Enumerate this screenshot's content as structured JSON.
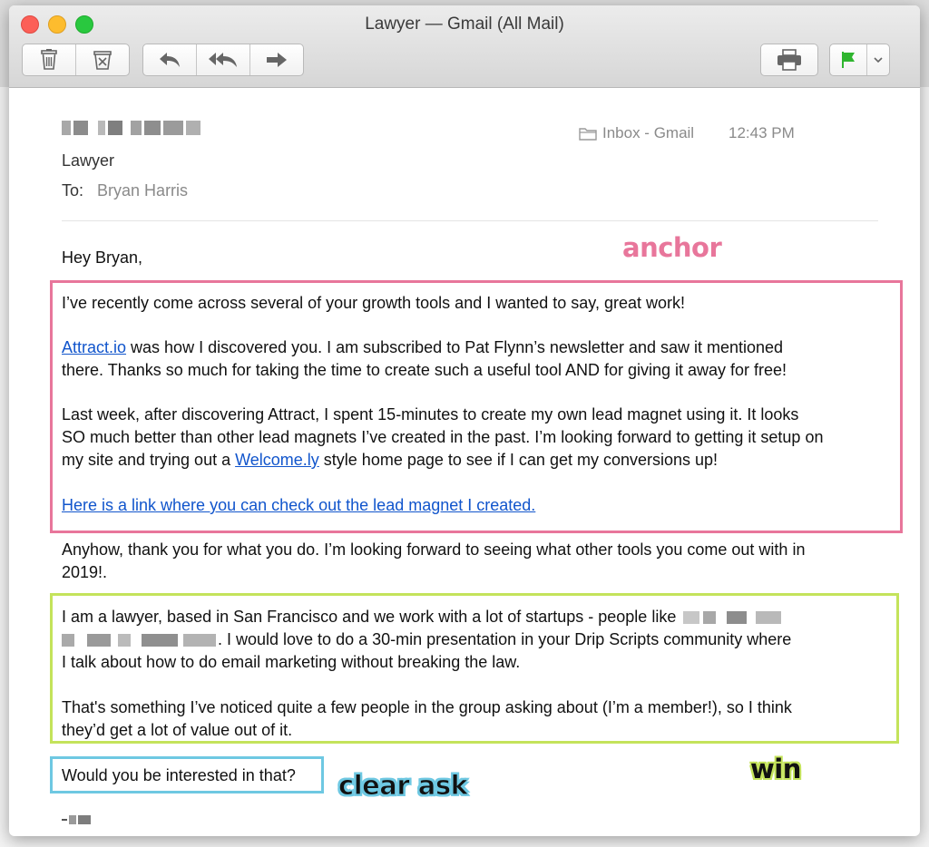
{
  "window": {
    "title": "Lawyer — Gmail (All Mail)"
  },
  "toolbar": {
    "trash_icon": "trash-icon",
    "junk_icon": "junk-icon",
    "reply_icon": "reply-icon",
    "reply_all_icon": "reply-all-icon",
    "forward_icon": "forward-icon",
    "print_icon": "printer-icon",
    "flag_icon": "flag-icon",
    "flag_color": "#2fb52f"
  },
  "message": {
    "subject": "Lawyer",
    "to_label": "To:",
    "to_name": "Bryan Harris",
    "mailbox": "Inbox - Gmail",
    "time": "12:43 PM",
    "greeting": "Hey Bryan,",
    "p1": "I’ve recently come across several of your growth tools and I wanted to say, great work!",
    "p2_link": "Attract.io",
    "p2_line1_rest": " was how I discovered you. I am subscribed to Pat Flynn’s newsletter and saw it mentioned",
    "p2_line2": "there. Thanks so much for taking the time to create such a useful tool AND for giving it away for free!",
    "p3_line1": "Last week, after discovering Attract, I spent 15-minutes to create my own lead magnet using it. It looks",
    "p3_line2": "SO much better than other lead magnets I’ve created in the past. I’m looking forward to getting it setup on",
    "p3_line3_pre": "my site and trying out a ",
    "p3_line3_link": "Welcome.ly",
    "p3_line3_post": " style home page to see if I can get my conversions up!",
    "p4_link": "Here is a link where you can check out the lead magnet I created.",
    "p5_line1": "Anyhow, thank you for what you do. I’m looking forward to seeing what other tools you come out with in",
    "p5_line2": "2019!.",
    "p6_line1": "I am a lawyer, based in San Francisco and we work with a lot of startups - people like",
    "p6_line2_post": ". I would love to do a 30-min presentation in your Drip Scripts community where",
    "p6_line3": "I talk about how to do email marketing without breaking the law.",
    "p7_line1": "That's something I’ve noticed quite a few people in the group asking about (I’m a member!), so I think",
    "p7_line2": "they’d get a lot of value out of it.",
    "ask": "Would you be interested in that?"
  },
  "annotations": {
    "anchor": "anchor",
    "clear_ask": "clear ask",
    "win": "win",
    "anchor_color": "#e8769b",
    "win_color": "#c4e35b",
    "ask_color": "#6ec8e2"
  }
}
